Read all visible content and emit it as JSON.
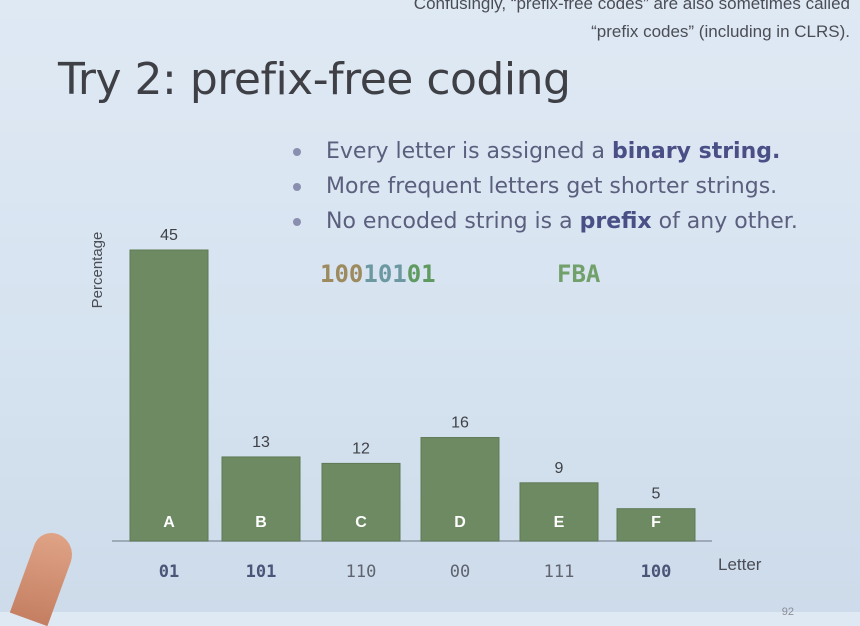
{
  "note": "Confusingly, “prefix-free codes” are also sometimes called “prefix codes” (including in CLRS).",
  "title": "Try 2: prefix-free coding",
  "bullets": [
    {
      "pre": "Every letter is assigned a ",
      "bold": "binary string.",
      "post": ""
    },
    {
      "pre": "More frequent letters get shorter strings.",
      "bold": "",
      "post": ""
    },
    {
      "pre": "No encoded string is a ",
      "bold": "prefix",
      "post": " of any other."
    }
  ],
  "encoding": {
    "chars": [
      {
        "c": "1",
        "color": "#9d8a5e"
      },
      {
        "c": "0",
        "color": "#9d8a5e"
      },
      {
        "c": "0",
        "color": "#9d8a5e"
      },
      {
        "c": "1",
        "color": "#6c98a2"
      },
      {
        "c": "0",
        "color": "#6c98a2"
      },
      {
        "c": "1",
        "color": "#6c98a2"
      },
      {
        "c": "0",
        "color": "#5f9a60"
      },
      {
        "c": "1",
        "color": "#5f9a60"
      }
    ],
    "decoded": "FBA"
  },
  "chart_data": {
    "type": "bar",
    "categories": [
      "A",
      "B",
      "C",
      "D",
      "E",
      "F"
    ],
    "values": [
      45,
      13,
      12,
      16,
      9,
      5
    ],
    "codes": [
      {
        "code": "01",
        "bold": true
      },
      {
        "code": "101",
        "bold": true
      },
      {
        "code": "110",
        "bold": false
      },
      {
        "code": "00",
        "bold": false
      },
      {
        "code": "111",
        "bold": false
      },
      {
        "code": "100",
        "bold": true
      }
    ],
    "xlabel": "Letter",
    "ylabel": "Percentage",
    "ylim": [
      0,
      50
    ],
    "bar_color": "#6e8a62",
    "bar_edge": "#5f7a55"
  },
  "page_number": "92"
}
